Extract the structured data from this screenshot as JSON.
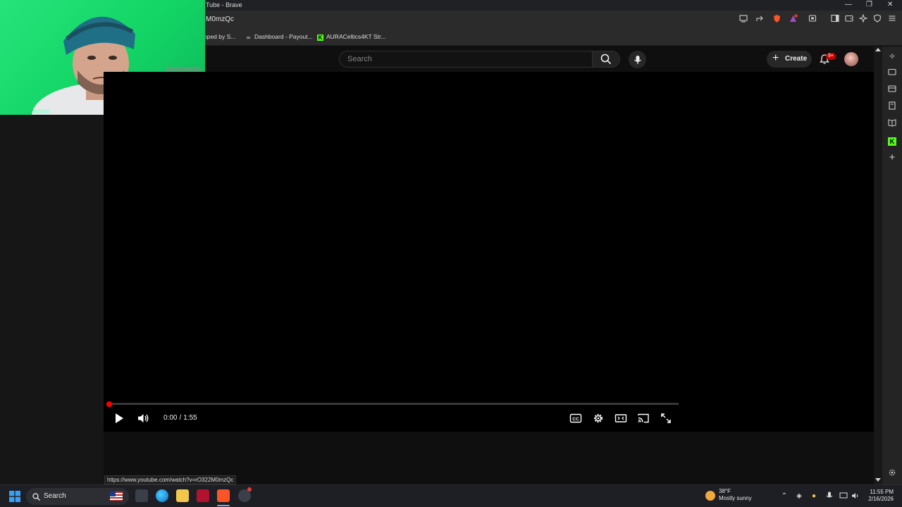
{
  "window": {
    "title": "Tube - Brave",
    "url_fragment": "M0mzQc",
    "controls": {
      "minimize": "—",
      "restore": "❐",
      "close": "✕"
    }
  },
  "bookmarks": [
    {
      "label": "pped by S...",
      "icon": "page-icon"
    },
    {
      "label": "Dashboard - Payout...",
      "icon": "link-icon"
    },
    {
      "label": "AURACeltics4KT Str...",
      "icon": "kick-icon"
    }
  ],
  "youtube_header": {
    "search_placeholder": "Search",
    "create_label": "Create",
    "notification_badge": "9+"
  },
  "player": {
    "current_time": "0:00",
    "separator": "/",
    "duration": "1:55",
    "progress_fraction": 0,
    "accent": "#ff0000"
  },
  "status_bar": {
    "url": "https://www.youtube.com/watch?v=rO322M0mzQc"
  },
  "taskbar": {
    "search_label": "Search",
    "weather_temp": "38°F",
    "weather_desc": "Mostly sunny",
    "time": "11:55 PM",
    "date": "2/16/2026"
  }
}
